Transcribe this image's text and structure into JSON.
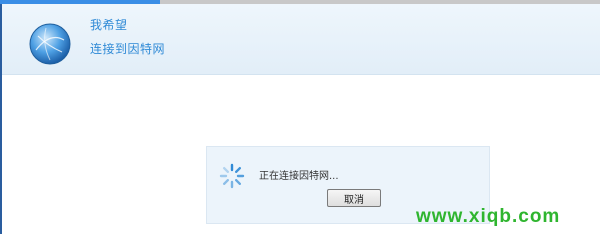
{
  "header": {
    "title": "我希望",
    "subtitle": "连接到因特网",
    "logo_icon": "globe-icon"
  },
  "dialog": {
    "status_text": "正在连接因特网...",
    "spinner_icon": "loading-spinner-icon",
    "cancel_label": "取消"
  },
  "watermark": {
    "text": "www.xiqb.com",
    "color": "#2fb52f"
  },
  "colors": {
    "accent": "#2f8ad6",
    "progress": "#3a8ee6"
  }
}
